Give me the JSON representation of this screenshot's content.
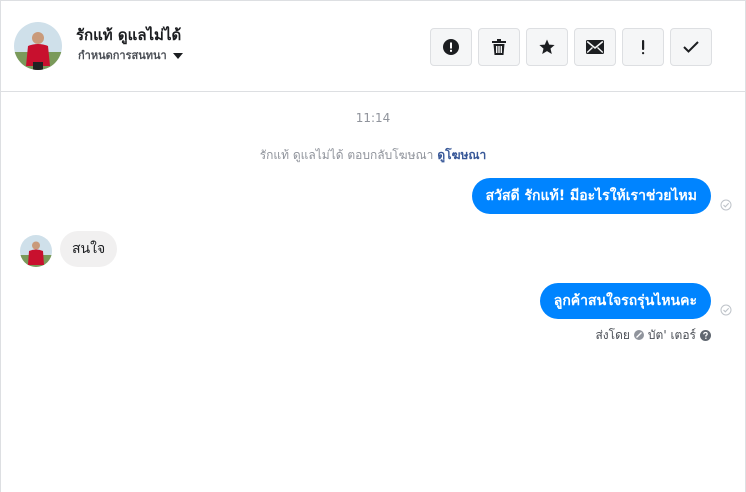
{
  "header": {
    "contact_name": "รักแท้ ดูแลไม่ได้",
    "assign_label": "กำหนดการสนทนา",
    "toolbar": [
      {
        "icon": "alert-circle-icon"
      },
      {
        "icon": "trash-icon"
      },
      {
        "icon": "star-icon"
      },
      {
        "icon": "envelope-icon"
      },
      {
        "icon": "exclamation-icon"
      },
      {
        "icon": "checkmark-icon"
      }
    ]
  },
  "thread": {
    "timestamp": "11:14",
    "ad_reply_text": "รักแท้ ดูแลไม่ได้ ตอบกลับโฆษณา",
    "ad_reply_link": "ดูโฆษณา",
    "messages": [
      {
        "direction": "outgoing",
        "text": "สวัสดี รักแท้! มีอะไรให้เราช่วยไหม"
      },
      {
        "direction": "incoming",
        "text": "สนใจ"
      },
      {
        "direction": "outgoing",
        "text": "ลูกค้าสนใจรถรุ่นไหนคะ"
      }
    ],
    "sent_by_label": "ส่งโดย",
    "sent_by_name": "บัต' เตอร์"
  },
  "colors": {
    "outgoing_bubble": "#0084ff",
    "incoming_bubble": "#f1f0f0",
    "link": "#385898",
    "muted_text": "#90949c",
    "toolbar_button_bg": "#f5f6f7"
  }
}
